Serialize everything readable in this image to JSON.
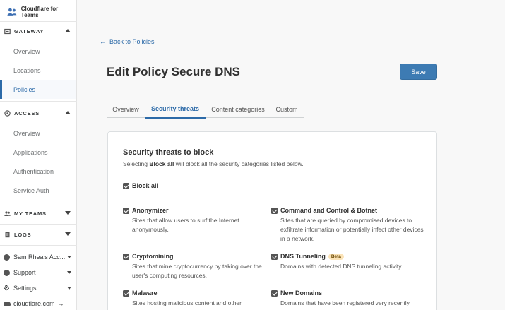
{
  "brand": {
    "name": "Cloudflare for Teams"
  },
  "sidebar": {
    "gateway": {
      "label": "GATEWAY",
      "items": [
        {
          "label": "Overview"
        },
        {
          "label": "Locations"
        },
        {
          "label": "Policies",
          "active": true
        }
      ]
    },
    "access": {
      "label": "ACCESS",
      "items": [
        {
          "label": "Overview"
        },
        {
          "label": "Applications"
        },
        {
          "label": "Authentication"
        },
        {
          "label": "Service Auth"
        }
      ]
    },
    "my_teams": {
      "label": "MY TEAMS"
    },
    "logs": {
      "label": "LOGS"
    },
    "footer": {
      "account": "Sam Rhea's Acc...",
      "support": "Support",
      "settings": "Settings",
      "cloudflare": "cloudflare.com"
    }
  },
  "main": {
    "back_link": "Back to Policies",
    "title_prefix": "Edit Policy",
    "title_name": "Secure DNS",
    "save_label": "Save",
    "tabs": [
      {
        "label": "Overview"
      },
      {
        "label": "Security threats",
        "active": true
      },
      {
        "label": "Content categories"
      },
      {
        "label": "Custom"
      }
    ],
    "card": {
      "title": "Security threats to block",
      "subtitle_pre": "Selecting",
      "subtitle_bold": "Block all",
      "subtitle_post": "will block all the security categories listed below.",
      "block_all": {
        "label": "Block all",
        "checked": true
      },
      "options": [
        {
          "label": "Anonymizer",
          "desc": "Sites that allow users to surf the Internet anonymously.",
          "checked": true
        },
        {
          "label": "Command and Control & Botnet",
          "desc": "Sites that are queried by compromised devices to exfiltrate information or potentially infect other devices in a network.",
          "checked": true
        },
        {
          "label": "Cryptomining",
          "desc": "Sites that mine cryptocurrency by taking over the user's computing resources.",
          "checked": true
        },
        {
          "label": "DNS Tunneling",
          "badge": "Beta",
          "desc": "Domains with detected DNS tunneling activity.",
          "checked": true
        },
        {
          "label": "Malware",
          "desc": "Sites hosting malicious content and other",
          "checked": true
        },
        {
          "label": "New Domains",
          "desc": "Domains that have been registered very recently.",
          "checked": true
        }
      ]
    }
  },
  "colors": {
    "accent": "#2c6aa8",
    "button": "#3d7bb3",
    "badge": "#fbe3b7"
  }
}
